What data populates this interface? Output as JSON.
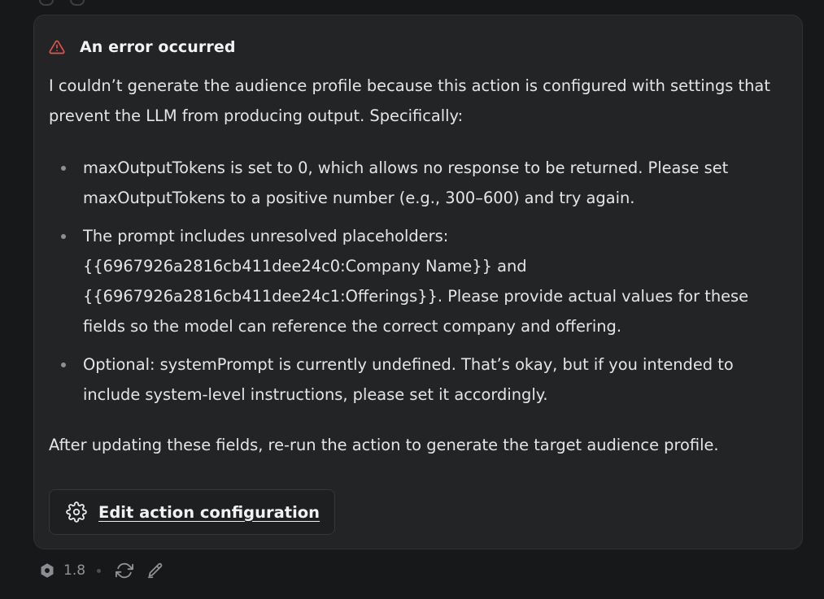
{
  "message": {
    "title": "An error occurred",
    "intro": "I couldn’t generate the audience profile because this action is configured with settings that prevent the LLM from producing output. Specifically:",
    "bullets": [
      "maxOutputTokens is set to 0, which allows no response to be returned. Please set maxOutputTokens to a positive number (e.g., 300–600) and try again.",
      "The prompt includes unresolved placeholders: {{6967926a2816cb411dee24c0:Company Name}} and {{6967926a2816cb411dee24c1:Offerings}}. Please provide actual values for these fields so the model can reference the correct company and offering.",
      "Optional: systemPrompt is currently undefined. That’s okay, but if you intended to include system-level instructions, please set it accordingly."
    ],
    "outro": "After updating these fields, re-run the action to generate the target audience profile.",
    "edit_button_label": "Edit action configuration"
  },
  "footer": {
    "version": "1.8",
    "icons": [
      "hexagon-icon",
      "refresh-icon",
      "pencil-icon"
    ]
  },
  "colors": {
    "background": "#171819",
    "card": "#222426",
    "warning": "#e5534b",
    "text": "#e4e5e7",
    "muted": "#8f9296"
  }
}
